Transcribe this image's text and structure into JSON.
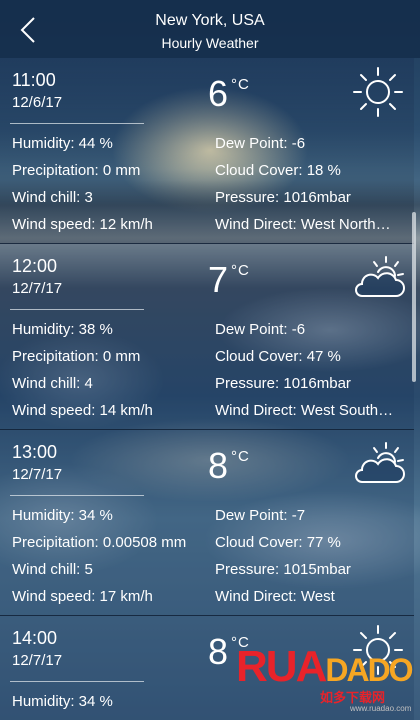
{
  "header": {
    "location": "New York, USA",
    "subtitle": "Hourly Weather",
    "back_icon": "chevron-left-icon"
  },
  "hours": [
    {
      "time": "11:00",
      "date": "12/6/17",
      "temp": "6",
      "unit": "°C",
      "icon": "sun-icon",
      "humidity": "Humidity: 44 %",
      "precipitation": "Precipitation: 0 mm",
      "wind_chill": "Wind chill: 3",
      "wind_speed": "Wind speed: 12 km/h",
      "dew_point": "Dew Point: -6",
      "cloud_cover": "Cloud Cover: 18 %",
      "pressure": "Pressure: 1016mbar",
      "wind_direct": "Wind Direct: West North…"
    },
    {
      "time": "12:00",
      "date": "12/7/17",
      "temp": "7",
      "unit": "°C",
      "icon": "partly-cloudy-icon",
      "humidity": "Humidity: 38 %",
      "precipitation": "Precipitation: 0 mm",
      "wind_chill": "Wind chill: 4",
      "wind_speed": "Wind speed: 14 km/h",
      "dew_point": "Dew Point: -6",
      "cloud_cover": "Cloud Cover: 47 %",
      "pressure": "Pressure: 1016mbar",
      "wind_direct": "Wind Direct: West South…"
    },
    {
      "time": "13:00",
      "date": "12/7/17",
      "temp": "8",
      "unit": "°C",
      "icon": "partly-cloudy-icon",
      "humidity": "Humidity: 34 %",
      "precipitation": "Precipitation: 0.00508 mm",
      "wind_chill": "Wind chill: 5",
      "wind_speed": "Wind speed: 17 km/h",
      "dew_point": "Dew Point: -7",
      "cloud_cover": "Cloud Cover: 77 %",
      "pressure": "Pressure: 1015mbar",
      "wind_direct": "Wind Direct: West"
    },
    {
      "time": "14:00",
      "date": "12/7/17",
      "temp": "8",
      "unit": "°C",
      "icon": "sun-icon",
      "humidity": "Humidity: 34 %"
    }
  ],
  "watermark": {
    "brand": "RUADADO",
    "brand_a": "RU",
    "brand_b": "A",
    "brand_c": "DADO",
    "chinese": "如多下载网",
    "url": "www.ruadao.com"
  },
  "colors": {
    "header_bg": "#142d4b",
    "text": "#ffffff",
    "watermark_red": "#e8232a",
    "watermark_orange": "#f6a623"
  }
}
